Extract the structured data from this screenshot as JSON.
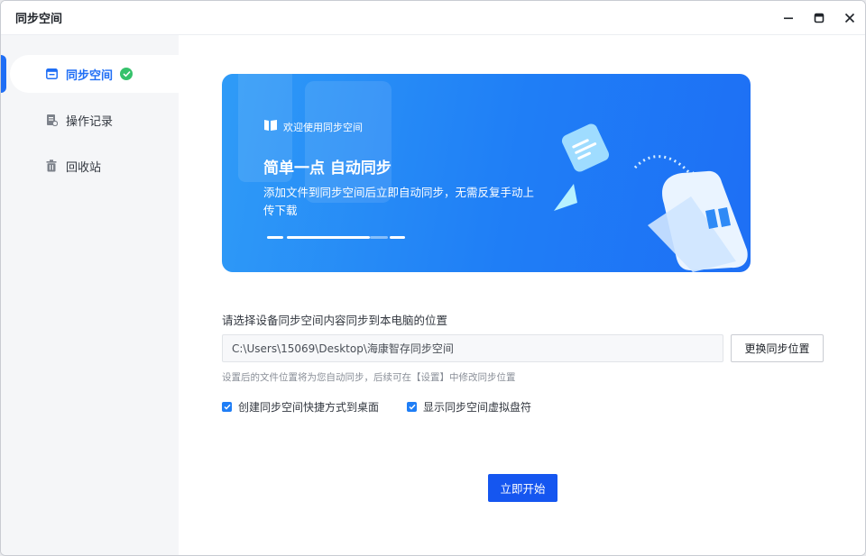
{
  "window": {
    "title": "同步空间",
    "controls": [
      "minimize-icon",
      "maximize-icon",
      "close-icon"
    ]
  },
  "sidebar": {
    "items": [
      {
        "label": "同步空间",
        "icon": "sync-folder-icon",
        "active": true,
        "status": "check-icon"
      },
      {
        "label": "操作记录",
        "icon": "log-icon",
        "active": false
      },
      {
        "label": "回收站",
        "icon": "trash-icon",
        "active": false
      }
    ]
  },
  "banner": {
    "welcome": "欢迎使用同步空间",
    "title": "简单一点 自动同步",
    "description": "添加文件到同步空间后立即自动同步，无需反复手动上传下载"
  },
  "settings": {
    "location_label": "请选择设备同步空间内容同步到本电脑的位置",
    "path_value": "C:\\Users\\15069\\Desktop\\海康智存同步空间",
    "change_button": "更换同步位置",
    "hint": "设置后的文件位置将为您自动同步，后续可在【设置】中修改同步位置",
    "checkbox_shortcut": {
      "label": "创建同步空间快捷方式到桌面",
      "checked": true
    },
    "checkbox_drive": {
      "label": "显示同步空间虚拟盘符",
      "checked": true
    }
  },
  "actions": {
    "start_button": "立即开始"
  },
  "colors": {
    "accent": "#1f6ef5",
    "primary_button": "#1556f0",
    "success": "#36c26b",
    "banner_gradient": [
      "#2f9bf7",
      "#1e6ff5"
    ]
  }
}
